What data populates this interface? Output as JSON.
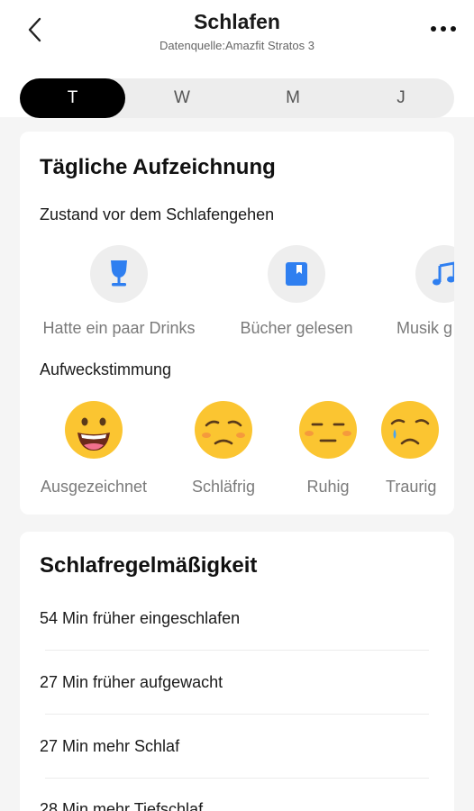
{
  "header": {
    "title": "Schlafen",
    "subtitle": "Datenquelle:Amazfit Stratos 3"
  },
  "tabs": [
    {
      "label": "T",
      "active": true
    },
    {
      "label": "W",
      "active": false
    },
    {
      "label": "M",
      "active": false
    },
    {
      "label": "J",
      "active": false
    }
  ],
  "daily": {
    "title": "Tägliche Aufzeichnung",
    "presleep_label": "Zustand vor dem Schlafengehen",
    "activities": [
      {
        "label": "Hatte ein paar Drinks",
        "icon": "drink-icon"
      },
      {
        "label": "Bücher gelesen",
        "icon": "book-icon"
      },
      {
        "label": "Musik g",
        "icon": "music-icon"
      }
    ],
    "wake_label": "Aufweckstimmung",
    "moods": [
      {
        "label": "Ausgezeichnet",
        "icon": "happy-face-icon"
      },
      {
        "label": "Schläfrig",
        "icon": "sleepy-face-icon"
      },
      {
        "label": "Ruhig",
        "icon": "calm-face-icon"
      },
      {
        "label": "Traurig",
        "icon": "sad-face-icon"
      }
    ]
  },
  "regularity": {
    "title": "Schlafregelmäßigkeit",
    "rows": [
      "54 Min früher eingeschlafen",
      "27 Min früher aufgewacht",
      "27 Min mehr Schlaf",
      "28 Min mehr Tiefschlaf"
    ]
  },
  "colors": {
    "accent_blue": "#2f7ff0",
    "emoji_yellow": "#fbc531",
    "tab_active": "#000000"
  }
}
